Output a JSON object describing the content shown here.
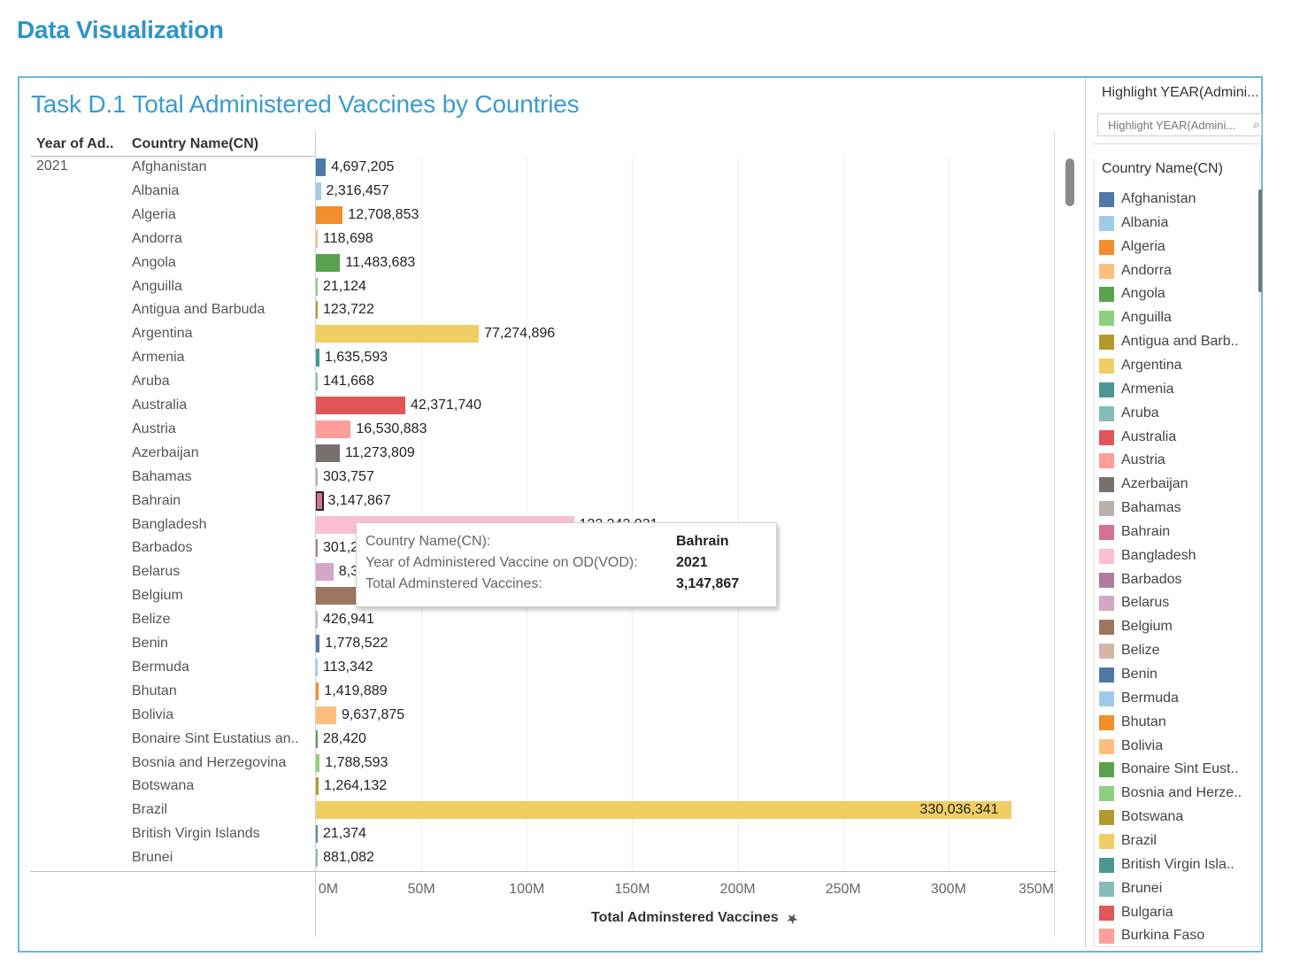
{
  "page": {
    "heading": "Data Visualization"
  },
  "chart_data": {
    "type": "bar",
    "title": "Task D.1 Total Administered Vaccines by Countries",
    "column_headers": [
      "Year of Ad..",
      "Country Name(CN)"
    ],
    "year": "2021",
    "xlabel": "Total Adminstered Vaccines",
    "xlim": [
      0,
      350000000
    ],
    "xticks": [
      {
        "v": 0,
        "label": "0M"
      },
      {
        "v": 50000000,
        "label": "50M"
      },
      {
        "v": 100000000,
        "label": "100M"
      },
      {
        "v": 150000000,
        "label": "150M"
      },
      {
        "v": 200000000,
        "label": "200M"
      },
      {
        "v": 250000000,
        "label": "250M"
      },
      {
        "v": 300000000,
        "label": "300M"
      },
      {
        "v": 350000000,
        "label": "350M"
      }
    ],
    "rows": [
      {
        "country": "Afghanistan",
        "value": 4697205,
        "label": "4,697,205",
        "color": "#4e79a7"
      },
      {
        "country": "Albania",
        "value": 2316457,
        "label": "2,316,457",
        "color": "#a0cbe8"
      },
      {
        "country": "Algeria",
        "value": 12708853,
        "label": "12,708,853",
        "color": "#f28e2b"
      },
      {
        "country": "Andorra",
        "value": 118698,
        "label": "118,698",
        "color": "#ffbe7d"
      },
      {
        "country": "Angola",
        "value": 11483683,
        "label": "11,483,683",
        "color": "#59a14f"
      },
      {
        "country": "Anguilla",
        "value": 21124,
        "label": "21,124",
        "color": "#8cd17d"
      },
      {
        "country": "Antigua and Barbuda",
        "value": 123722,
        "label": "123,722",
        "color": "#b6992d"
      },
      {
        "country": "Argentina",
        "value": 77274896,
        "label": "77,274,896",
        "color": "#f1ce63"
      },
      {
        "country": "Armenia",
        "value": 1635593,
        "label": "1,635,593",
        "color": "#499894"
      },
      {
        "country": "Aruba",
        "value": 141668,
        "label": "141,668",
        "color": "#86bcb6"
      },
      {
        "country": "Australia",
        "value": 42371740,
        "label": "42,371,740",
        "color": "#e15759"
      },
      {
        "country": "Austria",
        "value": 16530883,
        "label": "16,530,883",
        "color": "#ff9d9a"
      },
      {
        "country": "Azerbaijan",
        "value": 11273809,
        "label": "11,273,809",
        "color": "#79706e"
      },
      {
        "country": "Bahamas",
        "value": 303757,
        "label": "303,757",
        "color": "#bab0ac"
      },
      {
        "country": "Bahrain",
        "value": 3147867,
        "label": "3,147,867",
        "color": "#d37295",
        "selected": true
      },
      {
        "country": "Bangladesh",
        "value": 122343031,
        "label": "122,343,031",
        "color": "#fabfd2"
      },
      {
        "country": "Barbados",
        "value": 301200,
        "label": "301,2",
        "color": "#b07aa1"
      },
      {
        "country": "Belarus",
        "value": 8300000,
        "label": "8,3",
        "color": "#d4a6c8"
      },
      {
        "country": "Belgium",
        "value": 19000000,
        "label": "",
        "color": "#9d7660"
      },
      {
        "country": "Belize",
        "value": 426941,
        "label": "426,941",
        "color": "#d7b5a6"
      },
      {
        "country": "Benin",
        "value": 1778522,
        "label": "1,778,522",
        "color": "#4e79a7"
      },
      {
        "country": "Bermuda",
        "value": 113342,
        "label": "113,342",
        "color": "#a0cbe8"
      },
      {
        "country": "Bhutan",
        "value": 1419889,
        "label": "1,419,889",
        "color": "#f28e2b"
      },
      {
        "country": "Bolivia",
        "value": 9637875,
        "label": "9,637,875",
        "color": "#ffbe7d"
      },
      {
        "country": "Bonaire Sint Eustatius an..",
        "value": 28420,
        "label": "28,420",
        "color": "#59a14f"
      },
      {
        "country": "Bosnia and Herzegovina",
        "value": 1788593,
        "label": "1,788,593",
        "color": "#8cd17d"
      },
      {
        "country": "Botswana",
        "value": 1264132,
        "label": "1,264,132",
        "color": "#b6992d"
      },
      {
        "country": "Brazil",
        "value": 330036341,
        "label": "330,036,341",
        "color": "#f1ce63",
        "label_inside": true
      },
      {
        "country": "British Virgin Islands",
        "value": 21374,
        "label": "21,374",
        "color": "#499894"
      },
      {
        "country": "Brunei",
        "value": 881082,
        "label": "881,082",
        "color": "#86bcb6"
      }
    ]
  },
  "tooltip": {
    "rows": [
      {
        "key": "Country Name(CN):",
        "value": "Bahrain"
      },
      {
        "key": "Year of Administered Vaccine on OD(VOD):",
        "value": "2021"
      },
      {
        "key": "Total Adminstered Vaccines:",
        "value": "3,147,867"
      }
    ]
  },
  "sidebar": {
    "highlight_label": "Highlight YEAR(Admini...",
    "highlight_placeholder": "Highlight YEAR(Admini...",
    "legend_title": "Country Name(CN)",
    "legend": [
      {
        "name": "Afghanistan",
        "color": "#4e79a7"
      },
      {
        "name": "Albania",
        "color": "#a0cbe8"
      },
      {
        "name": "Algeria",
        "color": "#f28e2b"
      },
      {
        "name": "Andorra",
        "color": "#ffbe7d"
      },
      {
        "name": "Angola",
        "color": "#59a14f"
      },
      {
        "name": "Anguilla",
        "color": "#8cd17d"
      },
      {
        "name": "Antigua and Barb..",
        "color": "#b6992d"
      },
      {
        "name": "Argentina",
        "color": "#f1ce63"
      },
      {
        "name": "Armenia",
        "color": "#499894"
      },
      {
        "name": "Aruba",
        "color": "#86bcb6"
      },
      {
        "name": "Australia",
        "color": "#e15759"
      },
      {
        "name": "Austria",
        "color": "#ff9d9a"
      },
      {
        "name": "Azerbaijan",
        "color": "#79706e"
      },
      {
        "name": "Bahamas",
        "color": "#bab0ac"
      },
      {
        "name": "Bahrain",
        "color": "#d37295"
      },
      {
        "name": "Bangladesh",
        "color": "#fabfd2"
      },
      {
        "name": "Barbados",
        "color": "#b07aa1"
      },
      {
        "name": "Belarus",
        "color": "#d4a6c8"
      },
      {
        "name": "Belgium",
        "color": "#9d7660"
      },
      {
        "name": "Belize",
        "color": "#d7b5a6"
      },
      {
        "name": "Benin",
        "color": "#4e79a7"
      },
      {
        "name": "Bermuda",
        "color": "#a0cbe8"
      },
      {
        "name": "Bhutan",
        "color": "#f28e2b"
      },
      {
        "name": "Bolivia",
        "color": "#ffbe7d"
      },
      {
        "name": "Bonaire Sint Eust..",
        "color": "#59a14f"
      },
      {
        "name": "Bosnia and Herze..",
        "color": "#8cd17d"
      },
      {
        "name": "Botswana",
        "color": "#b6992d"
      },
      {
        "name": "Brazil",
        "color": "#f1ce63"
      },
      {
        "name": "British Virgin Isla..",
        "color": "#499894"
      },
      {
        "name": "Brunei",
        "color": "#86bcb6"
      },
      {
        "name": "Bulgaria",
        "color": "#e15759"
      },
      {
        "name": "Burkina Faso",
        "color": "#ff9d9a"
      }
    ]
  }
}
